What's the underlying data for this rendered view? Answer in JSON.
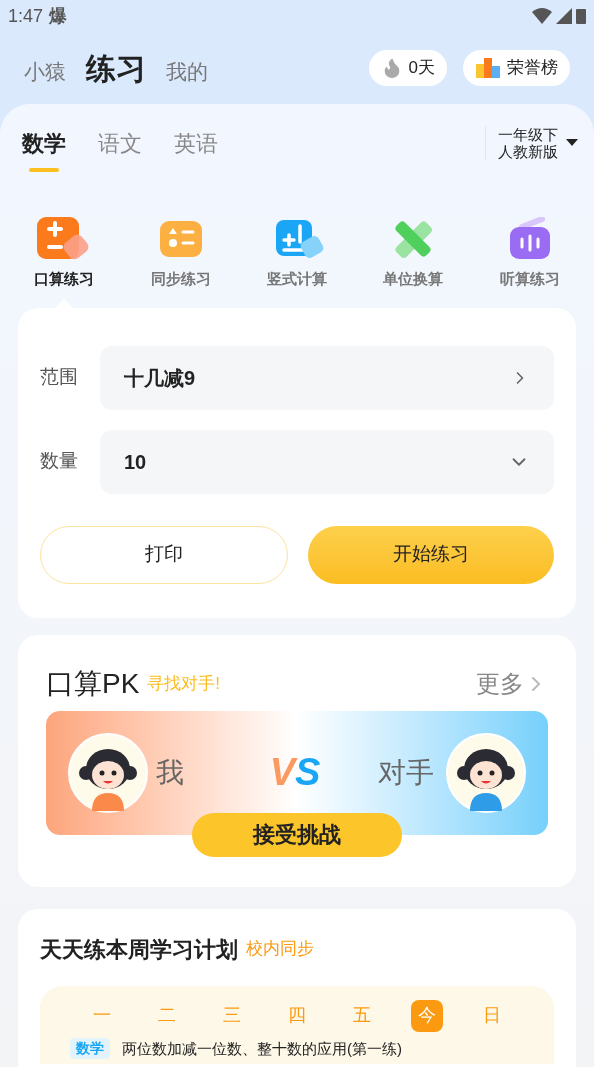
{
  "status_bar": {
    "time": "1:47",
    "glyph": "爆"
  },
  "top_nav": [
    {
      "label": "小猿",
      "selected": false
    },
    {
      "label": "练习",
      "selected": true
    },
    {
      "label": "我的",
      "selected": false
    }
  ],
  "streak": {
    "label": "0天"
  },
  "honor": {
    "label": "荣誉榜"
  },
  "subjects": [
    {
      "label": "数学",
      "selected": true
    },
    {
      "label": "语文",
      "selected": false
    },
    {
      "label": "英语",
      "selected": false
    }
  ],
  "grade": {
    "line1": "一年级下",
    "line2": "人教新版"
  },
  "modes": [
    {
      "kind": "oral",
      "label": "口算练习",
      "selected": true
    },
    {
      "kind": "sync",
      "label": "同步练习",
      "selected": false
    },
    {
      "kind": "vertical",
      "label": "竖式计算",
      "selected": false
    },
    {
      "kind": "unit",
      "label": "单位换算",
      "selected": false
    },
    {
      "kind": "listen",
      "label": "听算练习",
      "selected": false
    }
  ],
  "settings": [
    {
      "kind": "link",
      "label": "范围",
      "value": "十几减9"
    },
    {
      "kind": "dropdown",
      "label": "数量",
      "value": "10"
    }
  ],
  "buttons": {
    "print": "打印",
    "start": "开始练习"
  },
  "pk": {
    "title": "口算PK",
    "subtitle": "寻找对手!",
    "more": "更多",
    "me": "我",
    "vs_v": "V",
    "vs_s": "S",
    "opponent": "对手",
    "accept": "接受挑战"
  },
  "plan": {
    "title": "天天练本周学习计划",
    "tag": "校内同步",
    "days": [
      {
        "label": "一",
        "selected": false
      },
      {
        "label": "二",
        "selected": false
      },
      {
        "label": "三",
        "selected": false
      },
      {
        "label": "四",
        "selected": false
      },
      {
        "label": "五",
        "selected": false
      },
      {
        "label": "今",
        "selected": true
      },
      {
        "label": "日",
        "selected": false
      }
    ],
    "task": {
      "subject": "数学",
      "text": "两位数加减一位数、整十数的应用(第一练)"
    }
  }
}
